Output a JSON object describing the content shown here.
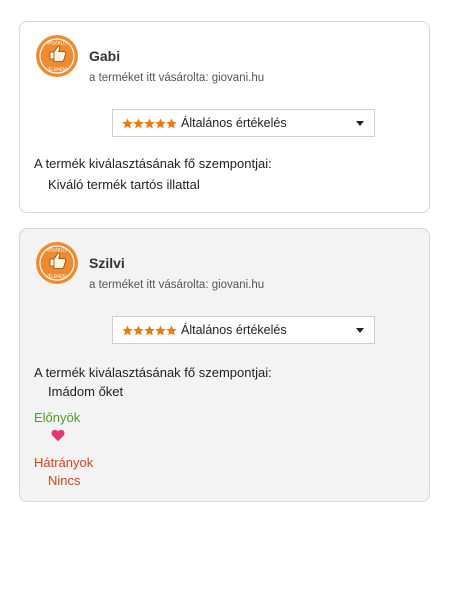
{
  "reviews": [
    {
      "badge_text_top": "VÁSÁRLÓI",
      "badge_text_bottom": "VÉLEMÉNY",
      "name": "Gabi",
      "bought_text": "a terméket itt vásárolta: giovani.hu",
      "rating_stars": 5,
      "rating_label": "Általános értékelés",
      "criteria_label": "A termék kiválasztásának fő szempontjai:",
      "criteria_value": "Kiváló termék tartós illattal"
    },
    {
      "badge_text_top": "VÁSÁRLÓI",
      "badge_text_bottom": "VÉLEMÉNY",
      "name": "Szilvi",
      "bought_text": "a terméket itt vásárolta: giovani.hu",
      "rating_stars": 5,
      "rating_label": "Általános értékelés",
      "criteria_label": "A termék kiválasztásának fő szempontjai:",
      "criteria_value": "Imádom őket",
      "pros_label": "Előnyök",
      "pros_icon": "heart-icon",
      "cons_label": "Hátrányok",
      "cons_value": "Nincs"
    }
  ],
  "colors": {
    "badge_orange": "#f08a2e",
    "star_orange": "#f07a10",
    "pros_green": "#4aa317",
    "cons_red": "#d2461e",
    "heart_pink": "#e8336d"
  }
}
